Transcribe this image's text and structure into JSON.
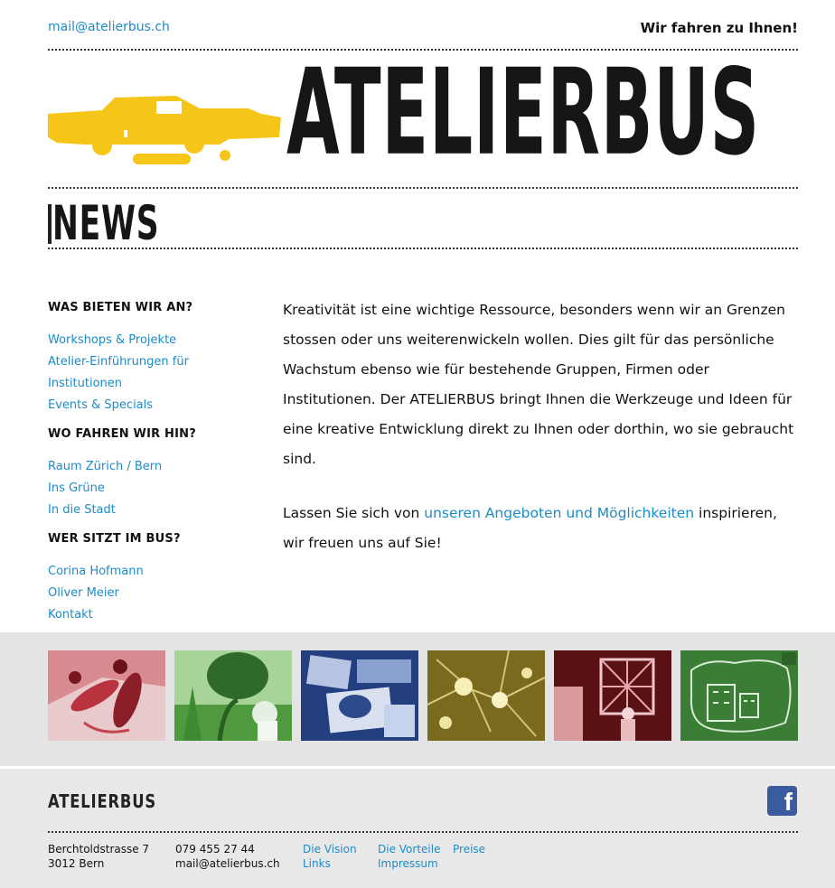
{
  "header": {
    "email": "mail@atelierbus.ch",
    "slogan": "Wir fahren zu Ihnen!",
    "brand": "ATELIERBUS"
  },
  "page_title": "NEWS",
  "sidebar": {
    "groups": [
      {
        "heading": "WAS BIETEN WIR AN?",
        "links": [
          "Workshops & Projekte",
          "Atelier-Einführungen für Institutionen",
          "Events & Specials"
        ]
      },
      {
        "heading": "WO FAHREN WIR HIN?",
        "links": [
          "Raum Zürich / Bern",
          "Ins Grüne",
          "In die Stadt"
        ]
      },
      {
        "heading": "WER SITZT IM BUS?",
        "links": [
          "Corina Hofmann",
          "Oliver Meier",
          "Kontakt"
        ]
      }
    ]
  },
  "main": {
    "paragraph1": "Kreativität ist eine wichtige Ressource, besonders wenn wir an Grenzen stossen oder uns weiterenwickeln wollen. Dies gilt für das persönliche Wachstum ebenso wie für bestehende Gruppen, Firmen oder Institutionen. Der ATELIERBUS bringt Ihnen die Werkzeuge und Ideen für eine kreative Entwicklung direkt zu Ihnen oder dorthin, wo sie gebraucht sind.",
    "paragraph2_before": "Lassen Sie sich von ",
    "paragraph2_link": "unseren Angeboten und Möglichkeiten",
    "paragraph2_after": " inspirieren, wir freuen uns auf Sie!"
  },
  "gallery": {
    "colors": [
      "#c7464f",
      "#3f9a3a",
      "#2f53a0",
      "#b89b1f",
      "#a8282c",
      "#3a8a3a"
    ]
  },
  "footer": {
    "brand": "ATELIERBUS",
    "facebook_icon": "facebook-icon",
    "address_line1": "Berchtoldstrasse 7",
    "address_line2": "3012 Bern",
    "phone": "079 455 27 44",
    "email": "mail@atelierbus.ch",
    "links_col1": [
      "Die Vision",
      "Links"
    ],
    "links_col2": [
      "Die Vorteile",
      "Impressum"
    ],
    "links_col3": [
      "Preise"
    ]
  },
  "colors": {
    "link": "#1d8bc9",
    "bus_yellow": "#f5c518",
    "facebook": "#3b5b9f"
  }
}
